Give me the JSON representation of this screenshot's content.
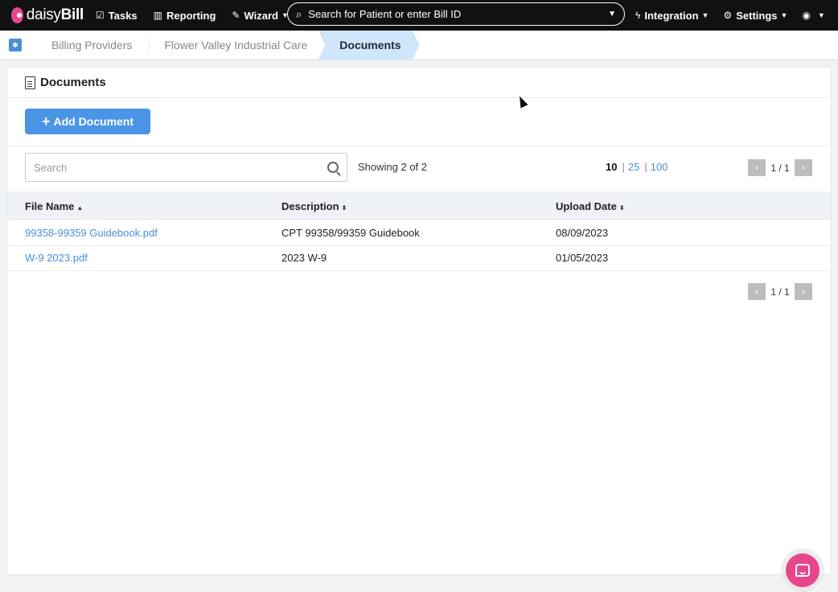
{
  "nav": {
    "logo_light": "daisy",
    "logo_bold": "Bill",
    "tasks": "Tasks",
    "reporting": "Reporting",
    "wizard": "Wizard",
    "search_placeholder": "Search for Patient or enter Bill ID",
    "integration": "Integration",
    "settings": "Settings"
  },
  "breadcrumb": [
    "Billing Providers",
    "Flower Valley Industrial Care",
    "Documents"
  ],
  "page": {
    "title": "Documents",
    "add_button": "Add Document",
    "search_placeholder": "Search",
    "showing": "Showing 2 of 2",
    "page_sizes": [
      "10",
      "25",
      "100"
    ],
    "page_info": "1 / 1"
  },
  "table": {
    "columns": [
      "File Name",
      "Description",
      "Upload Date"
    ],
    "rows": [
      {
        "file": "99358-99359 Guidebook.pdf",
        "description": "CPT 99358/99359 Guidebook",
        "date": "08/09/2023"
      },
      {
        "file": "W-9 2023.pdf",
        "description": "2023 W-9",
        "date": "01/05/2023"
      }
    ]
  },
  "colors": {
    "topbar": "#111111",
    "accent": "#4a95e6",
    "brand_pink": "#e8468a",
    "breadcrumb_active": "#cfe6fb"
  }
}
